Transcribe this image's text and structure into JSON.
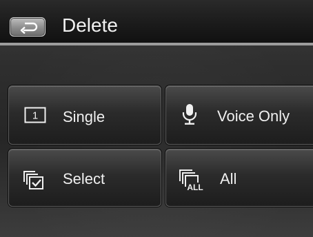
{
  "header": {
    "title": "Delete",
    "back_icon": "back-arrow-icon"
  },
  "options": [
    {
      "label": "Single",
      "icon": "single-frame-icon",
      "icon_text": "1"
    },
    {
      "label": "Voice Only",
      "icon": "microphone-icon"
    },
    {
      "label": "Select",
      "icon": "select-multiple-icon"
    },
    {
      "label": "All",
      "icon": "all-frames-icon",
      "icon_text": "ALL"
    }
  ],
  "colors": {
    "title_bar": "#1b1b1b",
    "divider": "#9c9c9c",
    "tile": "#2b2b2b",
    "text": "#f0f0f0"
  }
}
